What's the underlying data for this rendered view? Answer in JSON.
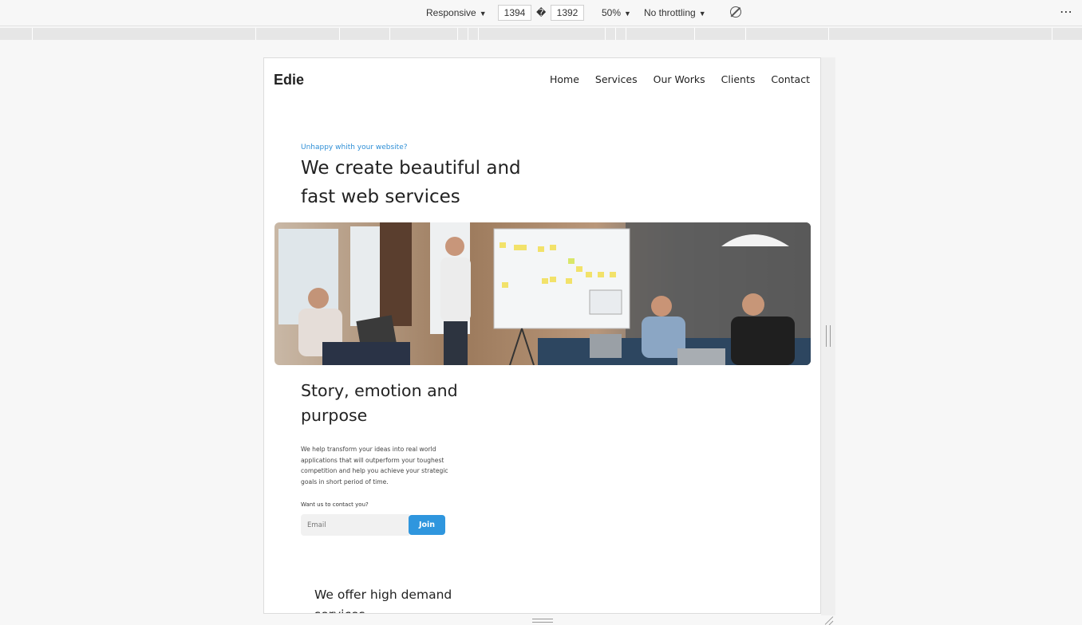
{
  "devtools": {
    "device_label": "Responsive",
    "width_value": "1394",
    "size_separator": "�",
    "height_value": "1392",
    "zoom_label": "50%",
    "throttle_label": "No throttling",
    "more_label": "⋯",
    "caret": "▼"
  },
  "site": {
    "logo": "Edie",
    "nav": [
      "Home",
      "Services",
      "Our Works",
      "Clients",
      "Contact"
    ],
    "hero": {
      "eyebrow": "Unhappy whith your website?",
      "title": "We create beautiful and fast web services"
    },
    "story": {
      "title": "Story, emotion and purpose",
      "body": "We help transform your ideas into real world applications that will outperform your toughest competition and help you achieve your strategic goals in short period of time.",
      "contact_label": "Want us to contact you?",
      "email_placeholder": "Email",
      "join_label": "Join"
    },
    "offer": {
      "title": "We offer high demand services"
    }
  }
}
